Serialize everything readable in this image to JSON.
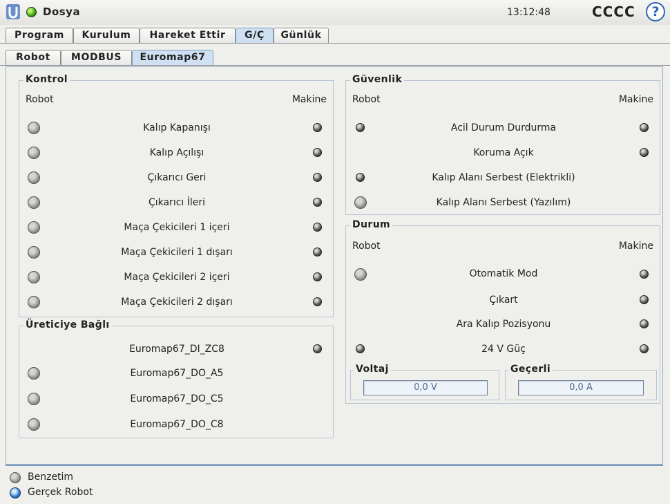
{
  "header": {
    "menu_label": "Dosya",
    "time": "13:12:48",
    "robot_name": "CCCC",
    "help_label": "?"
  },
  "main_tabs": [
    "Program",
    "Kurulum",
    "Hareket Ettir",
    "G/Ç",
    "Günlük"
  ],
  "active_main_tab": "G/Ç",
  "sub_tabs": [
    "Robot",
    "MODBUS",
    "Euromap67"
  ],
  "active_sub_tab": "Euromap67",
  "kontrol": {
    "title": "Kontrol",
    "robot_header": "Robot",
    "machine_header": "Makine",
    "rows": [
      "Kalıp Kapanışı",
      "Kalıp Açılışı",
      "Çıkarıcı Geri",
      "Çıkarıcı İleri",
      "Maça Çekicileri 1 içeri",
      "Maça Çekicileri 1 dışarı",
      "Maça Çekicileri 2 içeri",
      "Maça Çekicileri 2 dışarı"
    ]
  },
  "uretici": {
    "title": "Üreticiye Bağlı",
    "rows": [
      "Euromap67_DI_ZC8",
      "Euromap67_DO_A5",
      "Euromap67_DO_C5",
      "Euromap67_DO_C8"
    ]
  },
  "guvenlik": {
    "title": "Güvenlik",
    "robot_header": "Robot",
    "machine_header": "Makine",
    "rows": [
      "Acil Durum Durdurma",
      "Koruma Açık",
      "Kalıp Alanı Serbest (Elektrikli)",
      "Kalıp Alanı Serbest (Yazılım)"
    ]
  },
  "durum": {
    "title": "Durum",
    "robot_header": "Robot",
    "machine_header": "Makine",
    "rows": [
      "Otomatik Mod",
      "Çıkart",
      "Ara Kalıp Pozisyonu",
      "24 V Güç"
    ],
    "voltage_label": "Voltaj",
    "voltage_value": "0,0 V",
    "current_label": "Geçerli",
    "current_value": "0,0 A"
  },
  "footer": {
    "simulation_label": "Benzetim",
    "real_robot_label": "Gerçek Robot"
  }
}
